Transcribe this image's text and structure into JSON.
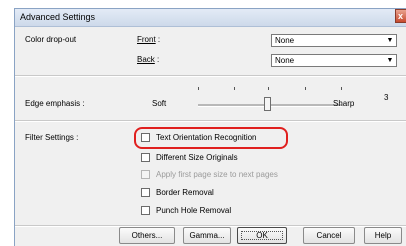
{
  "window": {
    "title": "Advanced Settings",
    "close_glyph": "x"
  },
  "color_dropout": {
    "label": "Color drop-out",
    "front_label": "Front",
    "back_label": "Back",
    "front_value": "None",
    "back_value": "None"
  },
  "edge_emphasis": {
    "label": "Edge emphasis :",
    "min_label": "Soft",
    "max_label": "Sharp",
    "value": "3",
    "level": 3,
    "level_max": 5
  },
  "filter": {
    "label": "Filter Settings :",
    "items": [
      {
        "label": "Text Orientation Recognition",
        "checked": false,
        "enabled": true
      },
      {
        "label": "Different Size Originals",
        "checked": false,
        "enabled": true
      },
      {
        "label": "Apply first page size to next pages",
        "checked": false,
        "enabled": false
      },
      {
        "label": "Border Removal",
        "checked": false,
        "enabled": true
      },
      {
        "label": "Punch Hole Removal",
        "checked": false,
        "enabled": true
      }
    ]
  },
  "buttons": {
    "others": "Others...",
    "gamma": "Gamma...",
    "ok": "OK",
    "cancel": "Cancel",
    "help": "Help"
  }
}
